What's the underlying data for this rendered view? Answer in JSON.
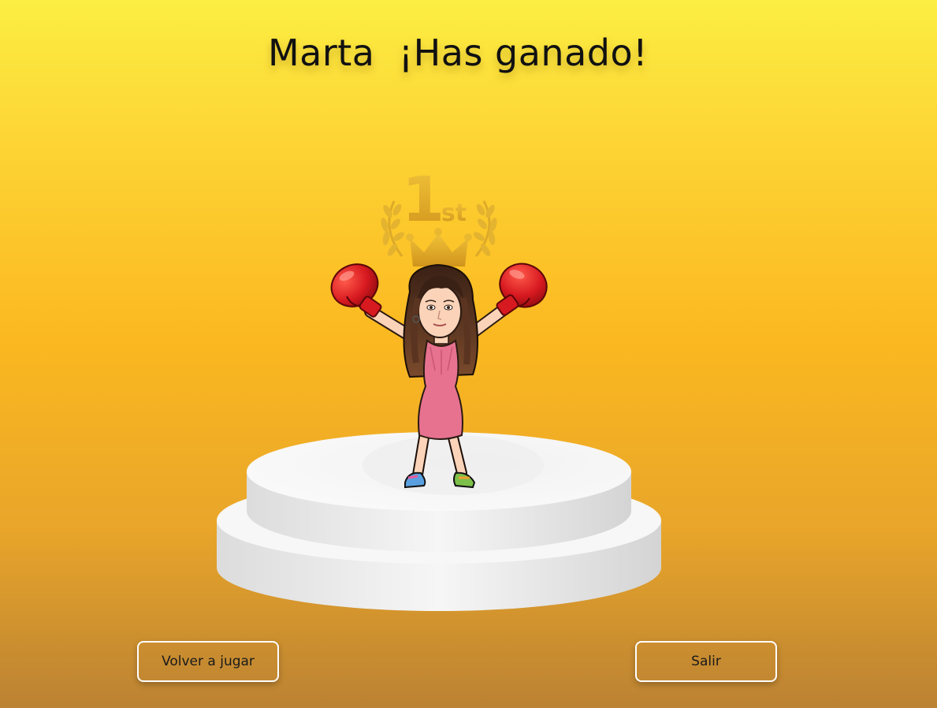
{
  "header": {
    "player_name": "Marta",
    "message": "¡Has ganado!"
  },
  "badge": {
    "rank_number": "1",
    "rank_suffix": "st"
  },
  "actions": {
    "replay_label": "Volver a jugar",
    "exit_label": "Salir"
  },
  "colors": {
    "background_top": "#fcee42",
    "background_bottom": "#bb8233",
    "gold": "#e0b030",
    "podium": "#f2f2f2",
    "dress": "#e7728f",
    "gloves": "#d71920"
  },
  "icons": {
    "winner_badge": "first-place-crown-laurel-icon",
    "avatar": "winner-avatar-boxing-gloves",
    "podium": "podium"
  }
}
